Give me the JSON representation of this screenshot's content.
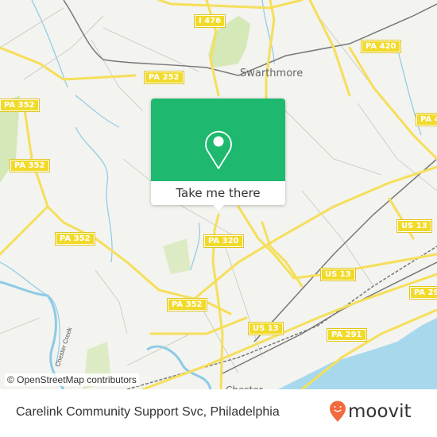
{
  "map": {
    "road_shields": [
      {
        "id": "i476",
        "label": "I 476"
      },
      {
        "id": "pa420",
        "label": "PA 420"
      },
      {
        "id": "pa252",
        "label": "PA 252"
      },
      {
        "id": "pa352-a",
        "label": "PA 352"
      },
      {
        "id": "pa352-b",
        "label": "PA 352"
      },
      {
        "id": "pa352-c",
        "label": "PA 352"
      },
      {
        "id": "pa352-d",
        "label": "PA 352"
      },
      {
        "id": "pa4xx",
        "label": "PA 4"
      },
      {
        "id": "pa320",
        "label": "PA 320"
      },
      {
        "id": "us13-a",
        "label": "US 13"
      },
      {
        "id": "us13-b",
        "label": "US 13"
      },
      {
        "id": "us13-c",
        "label": "US 13"
      },
      {
        "id": "pa291-a",
        "label": "PA 291"
      },
      {
        "id": "pa291-b",
        "label": "PA 29"
      }
    ],
    "places": [
      {
        "id": "swarthmore",
        "label": "Swarthmore"
      },
      {
        "id": "chester",
        "label": "Chester"
      }
    ],
    "water_labels": [
      {
        "id": "chester-creek",
        "label": "Chester Creek"
      }
    ],
    "attribution": "© OpenStreetMap contributors",
    "colors": {
      "land": "#f3f3ef",
      "road": "#f5df5a",
      "water": "#a8d8ec",
      "park": "#d4e8b8",
      "rail": "#777777"
    }
  },
  "popup": {
    "icon": "map-pin-icon",
    "button_label": "Take me there",
    "color": "#1eb86e"
  },
  "footer": {
    "place_name": "Carelink Community Support Svc, Philadelphia",
    "brand": "moovit",
    "brand_color": "#f26a3d"
  }
}
